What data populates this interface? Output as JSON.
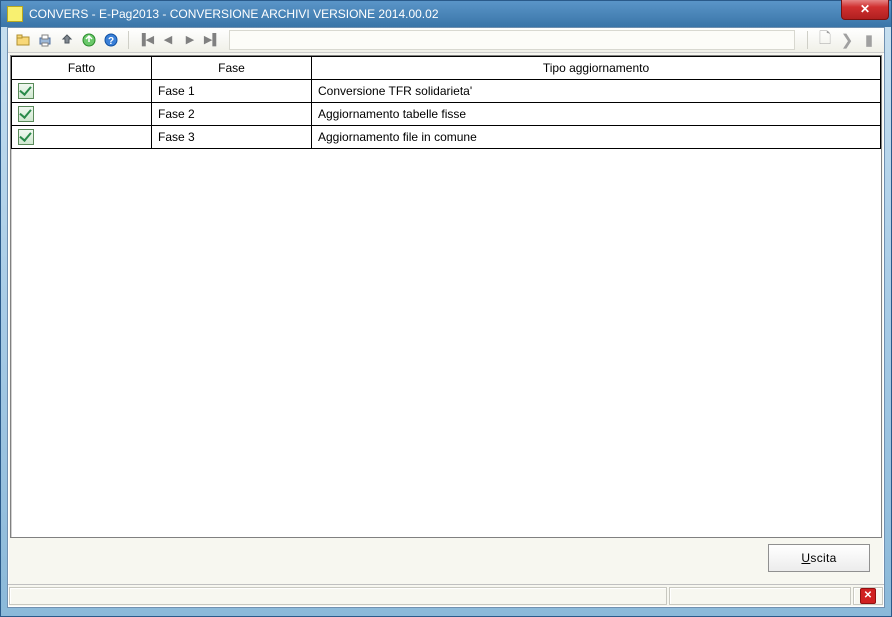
{
  "window": {
    "title": "CONVERS  - E-Pag2013  -  CONVERSIONE ARCHIVI VERSIONE 2014.00.02"
  },
  "toolbar": {
    "icons": {
      "open": "open-icon",
      "print": "print-icon",
      "recycle": "recycle-icon",
      "export": "export-icon",
      "help": "help-icon",
      "first": "nav-first-icon",
      "prev": "nav-prev-icon",
      "next": "nav-next-icon",
      "last": "nav-last-icon",
      "exit1": "exit-icon",
      "exit2": "exit-next-icon",
      "stop": "stop-icon"
    }
  },
  "grid": {
    "headers": {
      "done": "Fatto",
      "phase": "Fase",
      "desc": "Tipo aggiornamento"
    },
    "rows": [
      {
        "done": true,
        "phase": "Fase  1",
        "desc": "Conversione TFR solidarieta'"
      },
      {
        "done": true,
        "phase": "Fase  2",
        "desc": "Aggiornamento tabelle fisse"
      },
      {
        "done": true,
        "phase": "Fase  3",
        "desc": "Aggiornamento file in comune"
      }
    ]
  },
  "buttons": {
    "exit_prefix": "U",
    "exit_rest": "scita"
  }
}
